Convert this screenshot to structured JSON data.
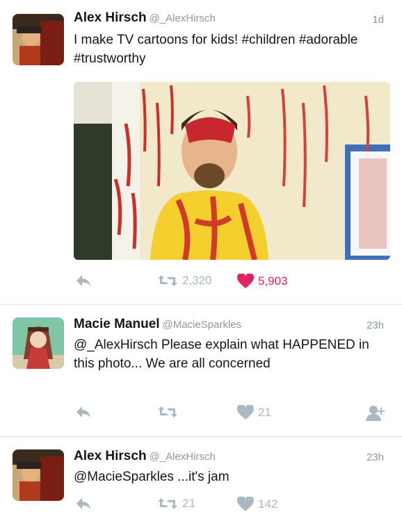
{
  "tweets": [
    {
      "name": "Alex Hirsch",
      "handle": "@_AlexHirsch",
      "time": "1d",
      "text": "I make TV cartoons for kids! #children #adorable #trustworthy",
      "retweets": "2,320",
      "likes": "5,903"
    },
    {
      "name": "Macie Manuel",
      "handle": "@MacieSparkles",
      "time": "23h",
      "text": "@_AlexHirsch Please explain what HAPPENED in this photo... We are all concerned",
      "retweets": "",
      "likes": "21"
    },
    {
      "name": "Alex Hirsch",
      "handle": "@_AlexHirsch",
      "time": "23h",
      "text": "@MacieSparkles ...it's jam",
      "retweets": "21",
      "likes": "142"
    }
  ],
  "colors": {
    "like_active": "#e0245e",
    "icon": "#aab8c2",
    "handle": "#8899a6"
  },
  "icons": [
    "reply-icon",
    "retweet-icon",
    "heart-icon",
    "follow-icon"
  ]
}
